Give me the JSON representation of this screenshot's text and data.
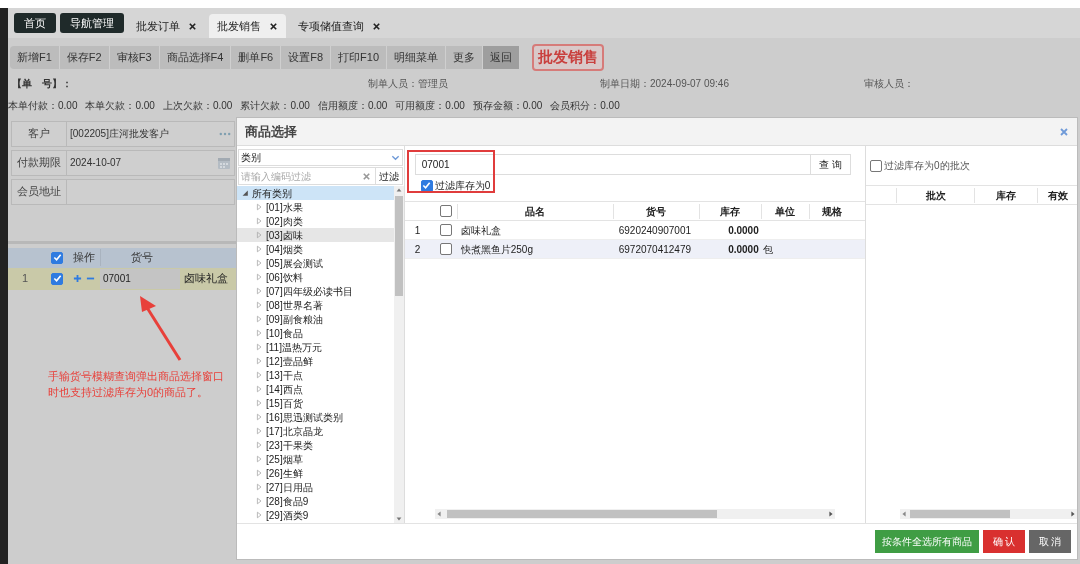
{
  "tabs": [
    {
      "label": "首页",
      "kind": "pinned",
      "selected": false
    },
    {
      "label": "导航管理",
      "kind": "pinned",
      "selected": false
    },
    {
      "label": "批发订单",
      "kind": "closable",
      "selected": false
    },
    {
      "label": "批发销售",
      "kind": "closable",
      "selected": true
    },
    {
      "label": "专项储值查询",
      "kind": "closable",
      "selected": false
    }
  ],
  "toolbar": {
    "buttons": [
      {
        "label": "新增F1",
        "selected": false
      },
      {
        "label": "保存F2",
        "selected": false
      },
      {
        "label": "审核F3",
        "selected": false
      },
      {
        "label": "商品选择F4",
        "selected": false
      },
      {
        "label": "删单F6",
        "selected": false
      },
      {
        "label": "设置F8",
        "selected": false
      },
      {
        "label": "打印F10",
        "selected": false
      },
      {
        "label": "明细菜单",
        "selected": false
      },
      {
        "label": "更多",
        "selected": false
      },
      {
        "label": "返回",
        "selected": true
      }
    ],
    "page_title": "批发销售"
  },
  "header_fields": [
    {
      "label": "【单　号】："
    },
    {
      "label": "制单人员：",
      "value": "管理员"
    },
    {
      "label": "制单日期：",
      "value": "2024-09-07 09:46"
    },
    {
      "label": "审核人员："
    }
  ],
  "totals": [
    {
      "label": "本单付款：",
      "value": "0.00"
    },
    {
      "label": "本单欠款：",
      "value": "0.00"
    },
    {
      "label": "上次欠款：",
      "value": "0.00"
    },
    {
      "label": "累计欠款：",
      "value": "0.00"
    },
    {
      "label": "信用额度：",
      "value": "0.00"
    },
    {
      "label": "可用额度：",
      "value": "0.00"
    },
    {
      "label": "预存金额：",
      "value": "0.00"
    },
    {
      "label": "会员积分：",
      "value": "0.00"
    }
  ],
  "form": [
    {
      "label": "客户",
      "value": "[002205]庄河批发客户",
      "kind": "lookup"
    },
    {
      "label": "付款期限",
      "value": "2024-10-07",
      "kind": "date"
    },
    {
      "label": "会员地址",
      "kind": "text"
    }
  ],
  "order_grid": {
    "columns": [
      "操作",
      "货号"
    ],
    "all_checked": true,
    "rows": [
      {
        "index": "1",
        "checked": true,
        "code": "07001",
        "name": "卤味礼盒"
      }
    ]
  },
  "annotation": "手输货号模糊查询弹出商品选择窗口时也支持过滤库存为0的商品了。",
  "dialog": {
    "title": "商品选择",
    "category_select": "类别",
    "filter_placeholder": "请输入编码过滤",
    "filter_button": "过滤",
    "tree": {
      "label": "所有类别",
      "expanded": true,
      "children": [
        {
          "label": "[01]水果",
          "selected": false
        },
        {
          "label": "[02]肉类",
          "selected": false
        },
        {
          "label": "[03]卤味",
          "selected": true
        },
        {
          "label": "[04]烟类",
          "selected": false
        },
        {
          "label": "[05]展会测试",
          "selected": false
        },
        {
          "label": "[06]饮料",
          "selected": false
        },
        {
          "label": "[07]四年级必读书目",
          "selected": false
        },
        {
          "label": "[08]世界名著",
          "selected": false
        },
        {
          "label": "[09]副食粮油",
          "selected": false
        },
        {
          "label": "[10]食品",
          "selected": false
        },
        {
          "label": "[11]温热万元",
          "selected": false
        },
        {
          "label": "[12]壹品鲜",
          "selected": false
        },
        {
          "label": "[13]干点",
          "selected": false
        },
        {
          "label": "[14]西点",
          "selected": false
        },
        {
          "label": "[15]百货",
          "selected": false
        },
        {
          "label": "[16]思迅测试类别",
          "selected": false
        },
        {
          "label": "[17]北京晶龙",
          "selected": false
        },
        {
          "label": "[23]干果类",
          "selected": false
        },
        {
          "label": "[25]烟草",
          "selected": false
        },
        {
          "label": "[26]生鲜",
          "selected": false
        },
        {
          "label": "[27]日用品",
          "selected": false
        },
        {
          "label": "[28]食品9",
          "selected": false
        },
        {
          "label": "[29]酒类9",
          "selected": false
        }
      ]
    },
    "search_value": "07001",
    "search_button": "查 询",
    "zero_filter": {
      "label": "过滤库存为0",
      "checked": true
    },
    "all_checked": false,
    "columns": [
      "品名",
      "货号",
      "库存",
      "单位",
      "规格"
    ],
    "rows": [
      {
        "index": "1",
        "checked": false,
        "selected": false,
        "name": "卤味礼盒",
        "code": "6920240907001",
        "stock": "0.0000"
      },
      {
        "index": "2",
        "checked": false,
        "selected": true,
        "name": "快煮黑鱼片250g",
        "code": "6972070412479",
        "stock": "0.0000",
        "unit": "包"
      }
    ],
    "batch_filter": {
      "label": "过滤库存为0的批次",
      "checked": false
    },
    "batch_columns": [
      "批次",
      "库存",
      "有效"
    ],
    "buttons": [
      {
        "label": "按条件全选所有商品",
        "kind": "select_all"
      },
      {
        "label": "确 认",
        "kind": "confirm"
      },
      {
        "label": "取 消",
        "kind": "cancel"
      }
    ]
  }
}
